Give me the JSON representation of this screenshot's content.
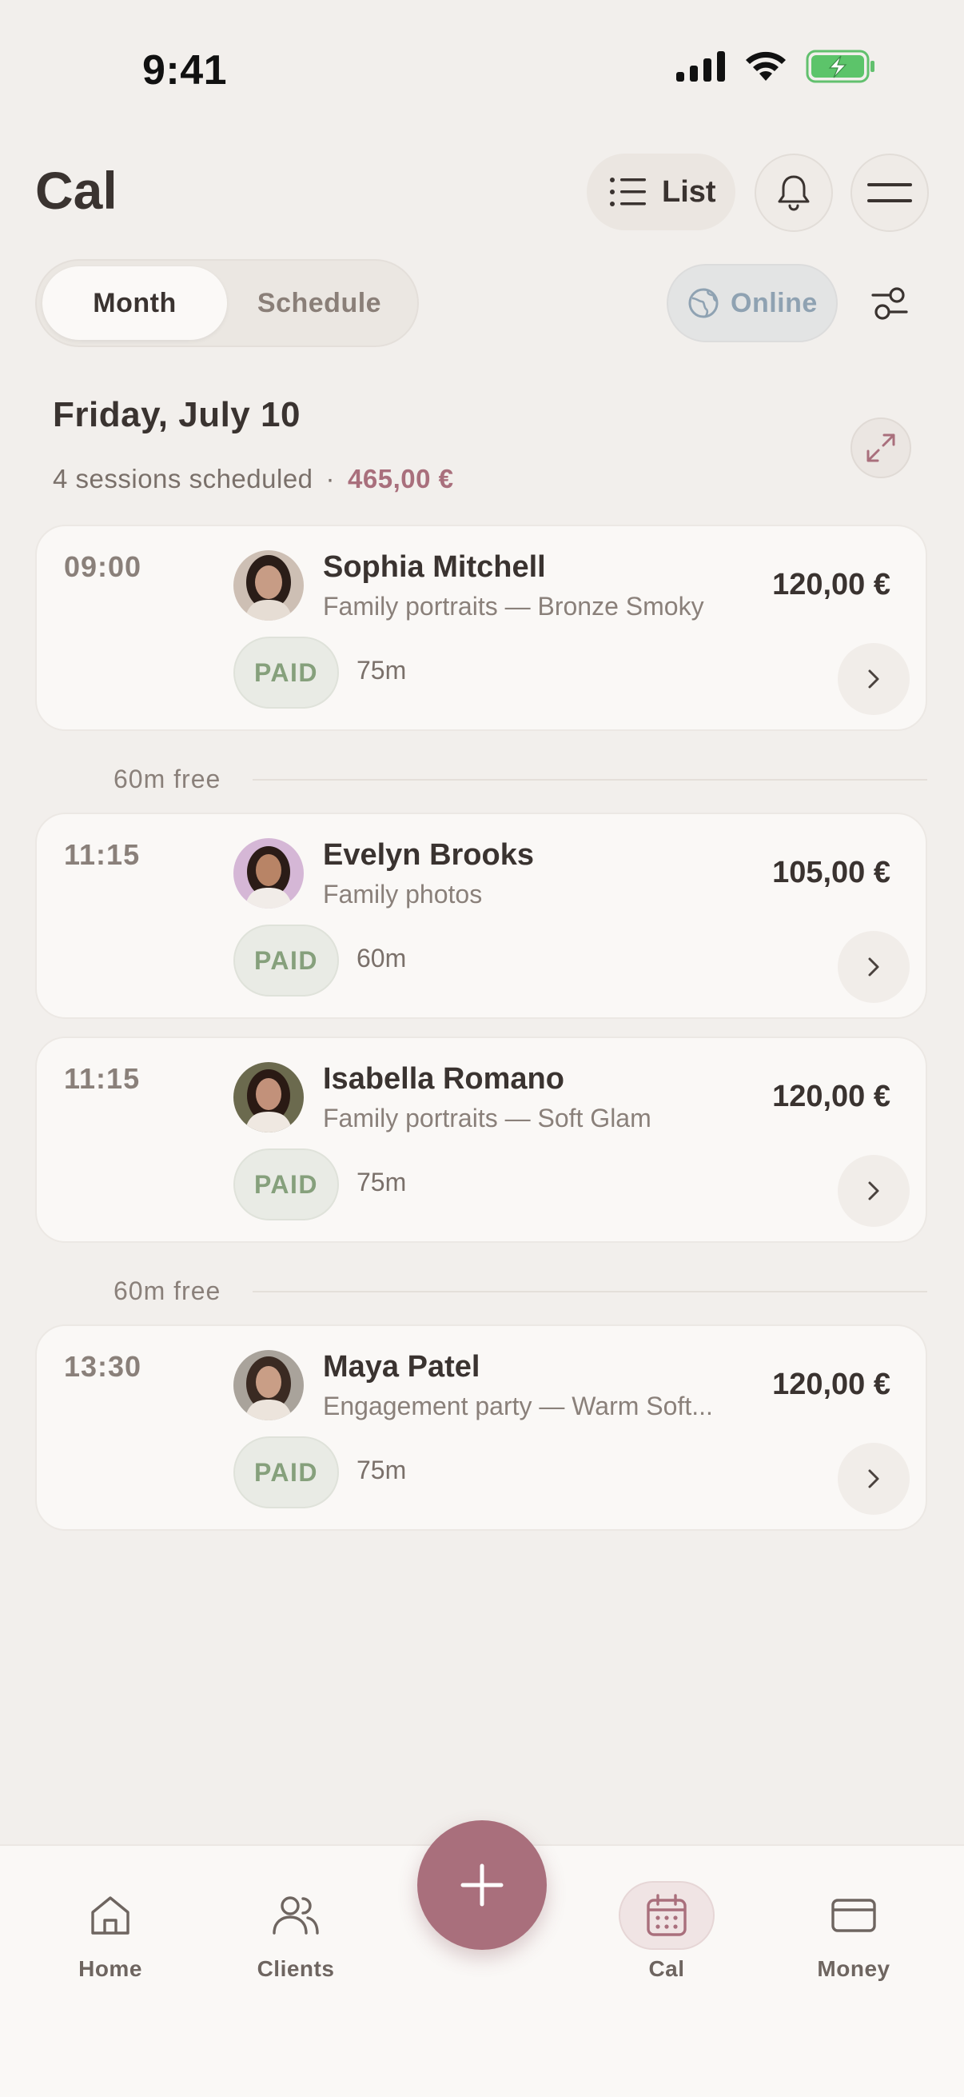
{
  "status_bar": {
    "time": "9:41"
  },
  "header": {
    "title": "Cal",
    "list_label": "List",
    "icons": [
      "list-icon",
      "bell-icon",
      "menu-icon"
    ]
  },
  "view_toggle": {
    "options": [
      "Month",
      "Schedule"
    ],
    "selected": "Month"
  },
  "online_label": "Online",
  "day": {
    "title": "Friday, July 10",
    "summary": "4 sessions scheduled",
    "separator": "·",
    "total": "465,00 €"
  },
  "sessions": [
    {
      "time": "09:00",
      "name": "Sophia Mitchell",
      "service": "Family portraits — Bronze Smoky",
      "price": "120,00 €",
      "status": "PAID",
      "duration": "75m"
    },
    {
      "time": "11:15",
      "name": "Evelyn Brooks",
      "service": "Family photos",
      "price": "105,00 €",
      "status": "PAID",
      "duration": "60m"
    },
    {
      "time": "11:15",
      "name": "Isabella Romano",
      "service": "Family portraits — Soft Glam",
      "price": "120,00 €",
      "status": "PAID",
      "duration": "75m"
    },
    {
      "time": "13:30",
      "name": "Maya Patel",
      "service": "Engagement party — Warm Soft...",
      "price": "120,00 €",
      "status": "PAID",
      "duration": "75m"
    }
  ],
  "gaps": [
    "60m free",
    "60m free"
  ],
  "nav": {
    "items": [
      {
        "label": "Home",
        "icon": "home-icon"
      },
      {
        "label": "Clients",
        "icon": "clients-icon"
      },
      {
        "label": "Cal",
        "icon": "calendar-icon"
      },
      {
        "label": "Money",
        "icon": "card-icon"
      }
    ],
    "active": "Cal",
    "fab_icon": "plus-icon"
  },
  "colors": {
    "accent": "#a96f7c",
    "background": "#f2efec",
    "card": "#faf8f6",
    "paid_green": "#86a07c",
    "online_blue": "#8fa2b2"
  }
}
